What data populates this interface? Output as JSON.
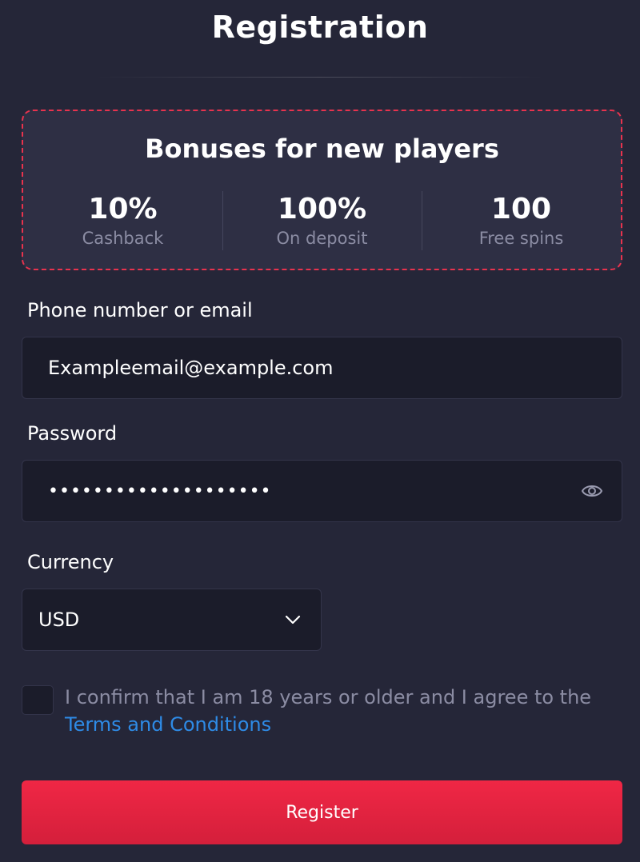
{
  "header": {
    "title": "Registration"
  },
  "bonus": {
    "title": "Bonuses for new players",
    "items": [
      {
        "value": "10%",
        "label": "Cashback"
      },
      {
        "value": "100%",
        "label": "On deposit"
      },
      {
        "value": "100",
        "label": "Free spins"
      }
    ]
  },
  "form": {
    "contact_label": "Phone number or email",
    "contact_value": "Exampleemail@example.com",
    "password_label": "Password",
    "password_mask": "••••••••••••••••••••",
    "currency_label": "Currency",
    "currency_value": "USD",
    "consent_text": "I confirm that I am 18 years or older and I agree to the",
    "terms_link": "Terms and Conditions",
    "register_label": "Register"
  },
  "colors": {
    "background": "#252638",
    "field_bg": "#1b1c2a",
    "accent_red": "#e8334e",
    "link_blue": "#2e8be6",
    "muted_text": "#8b8ca3"
  },
  "icons": {
    "password_toggle": "eye-icon",
    "currency_dropdown": "chevron-down-icon"
  }
}
